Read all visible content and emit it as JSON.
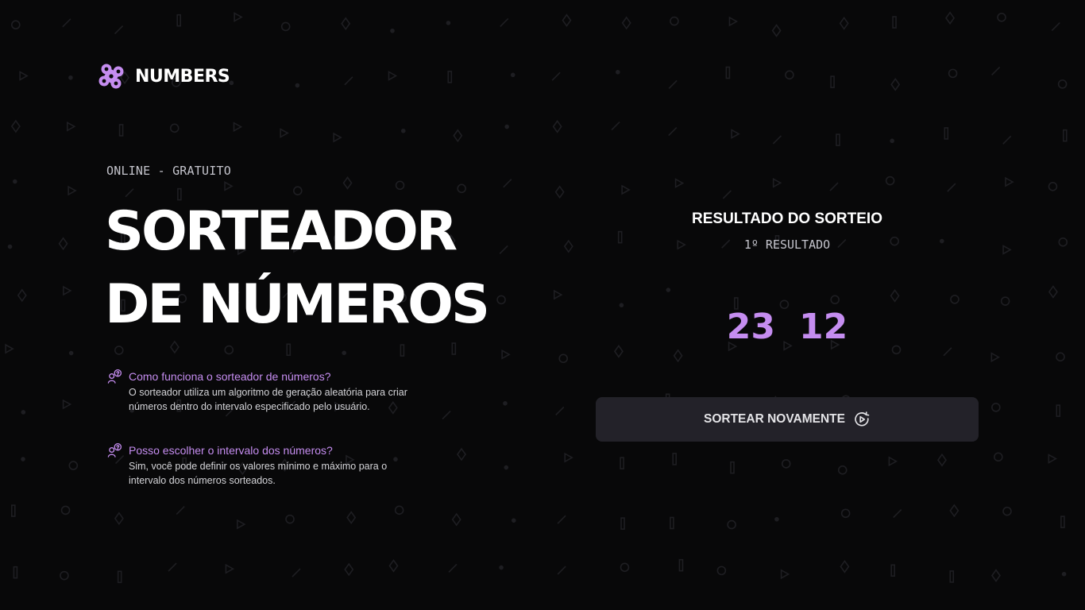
{
  "brand": {
    "name": "NUMBERS",
    "accent_color": "#c58df0",
    "logo_icon": "numbers-logo-icon"
  },
  "hero": {
    "eyebrow": "ONLINE - GRATUITO",
    "title_line1": "SORTEADOR",
    "title_line2": "DE NÚMEROS"
  },
  "faq": [
    {
      "icon": "chat-question-icon",
      "question": "Como funciona o sorteador de números?",
      "answer_line1": "O sorteador utiliza um algoritmo de geração aleatória para criar",
      "answer_line2": "números dentro do intervalo especificado pelo usuário."
    },
    {
      "icon": "chat-question-icon",
      "question": "Posso escolher o intervalo dos números?",
      "answer_line1": "Sim, você pode definir os valores mínimo e máximo para o",
      "answer_line2": "intervalo dos números sorteados."
    }
  ],
  "result": {
    "title": "RESULTADO DO SORTEIO",
    "subtitle": "1º RESULTADO",
    "numbers": [
      "23",
      "12"
    ]
  },
  "actions": {
    "draw_again_label": "SORTEAR NOVAMENTE",
    "draw_again_icon": "refresh-play-icon"
  },
  "colors": {
    "background": "#080809",
    "button_bg": "#232229",
    "text_muted": "#c4c4cc"
  }
}
